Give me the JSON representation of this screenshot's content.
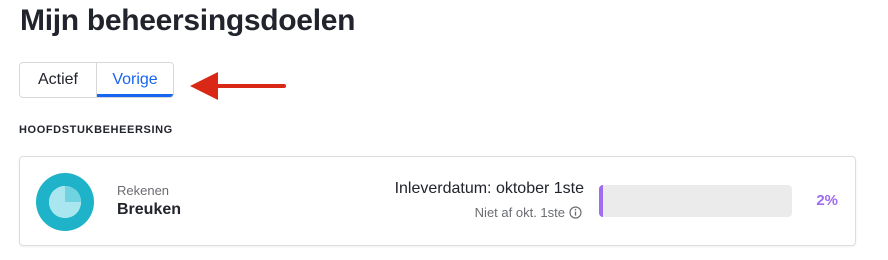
{
  "page": {
    "title": "Mijn beheersingsdoelen"
  },
  "tabs": [
    {
      "label": "Actief",
      "selected": false
    },
    {
      "label": "Vorige",
      "selected": true
    }
  ],
  "section": {
    "heading": "HOOFDSTUKBEHEERSING"
  },
  "assignment": {
    "icon": "pie-progress-icon",
    "subject": "Rekenen",
    "topic": "Breuken",
    "due_date": "Inleverdatum: oktober 1ste",
    "status": "Niet af okt. 1ste",
    "status_icon": "info-icon",
    "progress_percent": 2,
    "progress_label": "2%"
  },
  "annotation": {
    "icon": "red-arrow-icon"
  },
  "colors": {
    "accent_blue": "#1865f2",
    "progress_purple": "#a06cf0",
    "icon_teal": "#1eb3c8",
    "icon_teal_light": "#6fd3e2",
    "arrow_red": "#d92916"
  }
}
